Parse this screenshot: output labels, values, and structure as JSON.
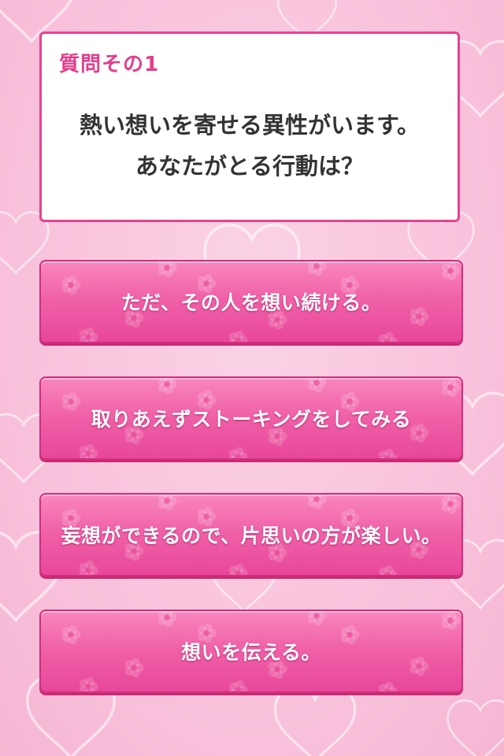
{
  "question": {
    "label": "質問その1",
    "line1": "熱い想いを寄せる異性がいます。",
    "line2": "あなたがとる行動は？"
  },
  "answers": [
    {
      "label": "ただ、その人を想い続ける。"
    },
    {
      "label": "取りあえずストーキングをしてみる"
    },
    {
      "label": "妄想ができるので、片思いの方が楽しい。"
    },
    {
      "label": "想いを伝える。"
    }
  ],
  "colors": {
    "accent": "#e9418f",
    "background": "#f9c6de",
    "button": "#f062a9",
    "text": "#333333"
  },
  "icons": {
    "background_pattern": "heart-outline-icon",
    "button_pattern": "flower-icon"
  }
}
